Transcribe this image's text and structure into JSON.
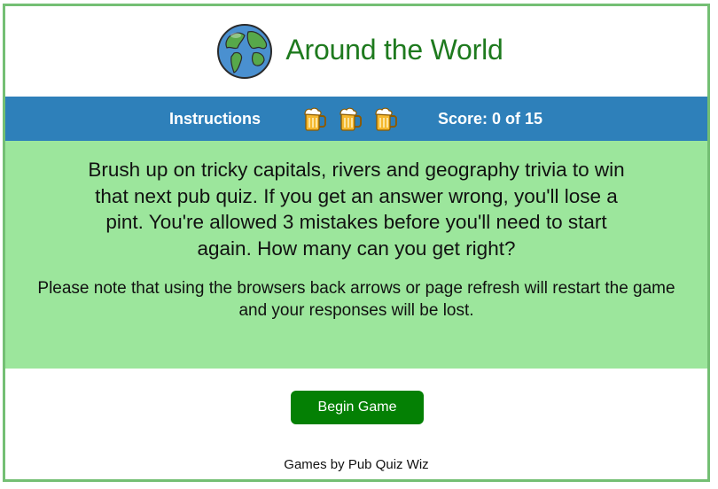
{
  "header": {
    "title": "Around the World",
    "logo_icon": "globe-icon"
  },
  "navbar": {
    "instructions_label": "Instructions",
    "lives_icon": "beer-mug-icon",
    "lives_remaining": 3,
    "score_text": "Score: 0 of 15"
  },
  "content": {
    "lead": "Brush up on tricky capitals, rivers and geography trivia to win that next pub quiz. If you get an answer wrong, you'll lose a pint. You're allowed 3 mistakes before you'll need to start again. How many can you get right?",
    "note": "Please note that using the browsers back arrows or page refresh will restart the game and your responses will be lost."
  },
  "actions": {
    "begin_label": "Begin Game"
  },
  "footer": {
    "credit": "Games by Pub Quiz Wiz"
  },
  "colors": {
    "border": "#74bf74",
    "title": "#1e7a1e",
    "navbar": "#2e80ba",
    "content_bg": "#9ce69c",
    "button": "#048004"
  }
}
